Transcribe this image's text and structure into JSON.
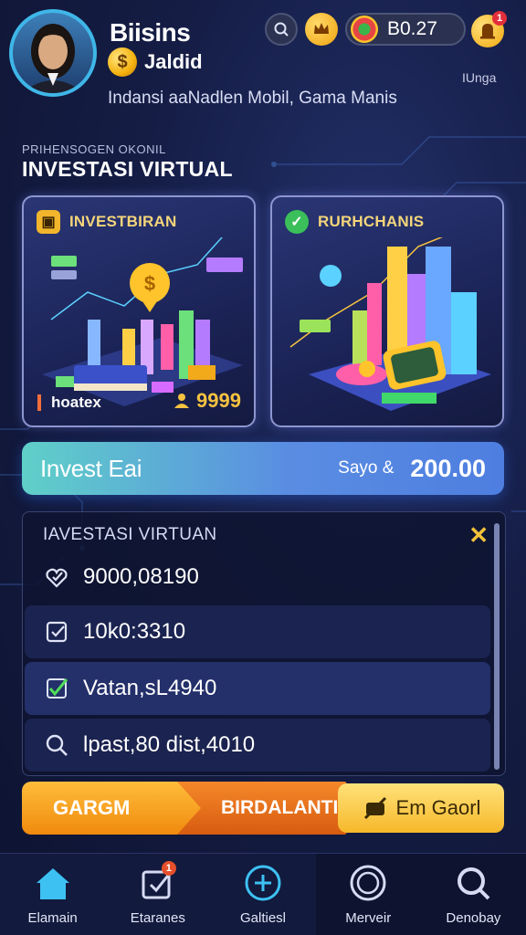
{
  "header": {
    "user_name": "Biisins",
    "coin_symbol": "$",
    "coin_label": "Jaldid",
    "subtitle": "Indansi aaNadlen Mobil, Gama Manis",
    "balance": "B0.27",
    "notification_badge": "1",
    "top_right_label": "IUnga"
  },
  "section": {
    "kicker": "PRIHENSOGEN OKONIL",
    "title": "INVESTASI VIRTUAL"
  },
  "cards": [
    {
      "title": "INVESTBIRAN",
      "icon": "briefcase-icon",
      "footer_left": "hoatex",
      "footer_right": "9999"
    },
    {
      "title": "RURHCHANIS",
      "icon": "check-circle-icon"
    }
  ],
  "invest_bar": {
    "label": "Invest Eai",
    "sub": "Sayo &",
    "amount": "200.00"
  },
  "panel": {
    "title": "IAVESTASI VIRTUAN",
    "rows": [
      {
        "value": "9000,08190",
        "icon": "heart-check-icon"
      },
      {
        "value": "10k0:3310",
        "icon": "checkbox-icon"
      },
      {
        "value": "Vatan,sL4940",
        "icon": "checkmark-icon"
      },
      {
        "value": "lpast,80 dist,4010",
        "icon": "search-icon"
      }
    ]
  },
  "actions": {
    "primary": "GARGM",
    "secondary": "BIRDALANTI",
    "tertiary": "Em Gaorl"
  },
  "nav": [
    {
      "label": "Elamain",
      "icon": "home-icon"
    },
    {
      "label": "Etaranes",
      "icon": "edit-icon",
      "badge": "1"
    },
    {
      "label": "Galtiesl",
      "icon": "plus-circle-icon"
    },
    {
      "label": "Merveir",
      "icon": "coin-icon"
    },
    {
      "label": "Denobay",
      "icon": "search-icon"
    }
  ],
  "colors": {
    "accent_cyan": "#3fb6e8",
    "gold": "#f4b10e",
    "orange": "#f08a0e",
    "bg_dark": "#151d45"
  }
}
